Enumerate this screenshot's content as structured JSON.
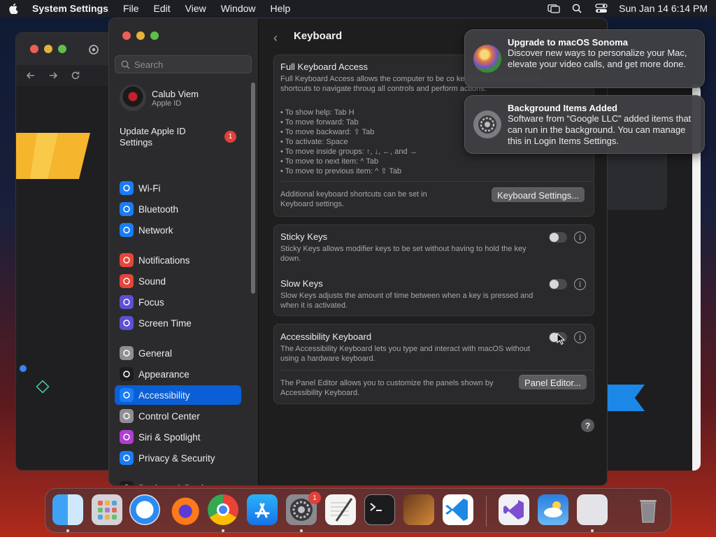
{
  "menubar": {
    "app_name": "System Settings",
    "items": [
      "File",
      "Edit",
      "View",
      "Window",
      "Help"
    ],
    "clock": "Sun Jan 14  6:14 PM"
  },
  "sidebar": {
    "search_placeholder": "Search",
    "user_name": "Calub Viem",
    "user_sub": "Apple ID",
    "update_label": "Update Apple ID Settings",
    "update_badge": "1",
    "items": [
      {
        "label": "Wi-Fi",
        "icon": "wifi-icon",
        "color": "#1a7cf5"
      },
      {
        "label": "Bluetooth",
        "icon": "bluetooth-icon",
        "color": "#1a7cf5"
      },
      {
        "label": "Network",
        "icon": "network-icon",
        "color": "#1a7cf5"
      },
      {
        "label": "Notifications",
        "icon": "notifications-icon",
        "color": "#e6453b"
      },
      {
        "label": "Sound",
        "icon": "sound-icon",
        "color": "#e6453b"
      },
      {
        "label": "Focus",
        "icon": "focus-icon",
        "color": "#5e4fd6"
      },
      {
        "label": "Screen Time",
        "icon": "screen-time-icon",
        "color": "#5e4fd6"
      },
      {
        "label": "General",
        "icon": "general-icon",
        "color": "#8e8e93"
      },
      {
        "label": "Appearance",
        "icon": "appearance-icon",
        "color": "#1c1c1e"
      },
      {
        "label": "Accessibility",
        "icon": "accessibility-icon",
        "color": "#1a7cf5",
        "active": true
      },
      {
        "label": "Control Center",
        "icon": "control-center-icon",
        "color": "#8e8e93"
      },
      {
        "label": "Siri & Spotlight",
        "icon": "siri-icon",
        "color": "#b03fd0"
      },
      {
        "label": "Privacy & Security",
        "icon": "privacy-icon",
        "color": "#1a7cf5"
      },
      {
        "label": "Desktop & Dock",
        "icon": "desktop-dock-icon",
        "color": "#1c1c1e"
      }
    ]
  },
  "content": {
    "title": "Keyboard",
    "fka": {
      "heading": "Full Keyboard Access",
      "desc": "Full Keyboard Access allows the computer to be co keyboard. Use keyboard shortcuts to navigate throug all controls and perform actions.",
      "shortcuts": [
        "• To show help: Tab H",
        "• To move forward: Tab",
        "• To move backward: ⇧ Tab",
        "• To activate: Space",
        "• To move inside groups: ↑, ↓, ←, and →",
        "• To move to next item: ^ Tab",
        "• To move to previous item: ^ ⇧ Tab"
      ],
      "additional": "Additional keyboard shortcuts can be set in Keyboard settings.",
      "button": "Keyboard Settings..."
    },
    "sticky": {
      "heading": "Sticky Keys",
      "desc": "Sticky Keys allows modifier keys to be set without having to hold the key down."
    },
    "slow": {
      "heading": "Slow Keys",
      "desc": "Slow Keys adjusts the amount of time between when a key is pressed and when it is activated."
    },
    "acc_kb": {
      "heading": "Accessibility Keyboard",
      "desc": "The Accessibility Keyboard lets you type and interact with macOS without using a hardware keyboard.",
      "panel_desc": "The Panel Editor allows you to customize the panels shown by Accessibility Keyboard.",
      "button": "Panel Editor..."
    },
    "help": "?"
  },
  "notifications": [
    {
      "title": "Upgrade to macOS Sonoma",
      "body": "Discover new ways to personalize your Mac, elevate your video calls, and get more done."
    },
    {
      "title": "Background Items Added",
      "body": "Software from “Google LLC” added items that can run in the background. You can manage this in Login Items Settings."
    }
  ],
  "dock": {
    "apps": [
      "Finder",
      "Launchpad",
      "Safari",
      "Firefox",
      "Chrome",
      "App Store",
      "System Settings",
      "TextEdit",
      "Terminal",
      "Instruments",
      "Visual Studio Code",
      "Visual Studio",
      "Weather",
      "Preview",
      "Trash"
    ],
    "settings_badge": "1"
  }
}
